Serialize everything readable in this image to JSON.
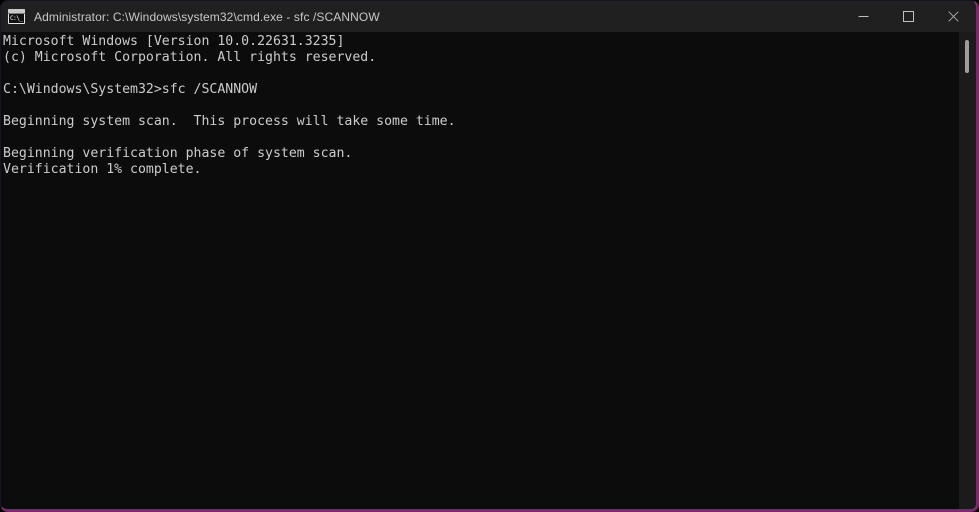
{
  "window": {
    "title": "Administrator: C:\\Windows\\system32\\cmd.exe - sfc  /SCANNOW",
    "icon_name": "cmd-exe-icon",
    "icon_glyph": "C:\\_",
    "background_color": "#0c0c0c",
    "titlebar_color": "#202020",
    "border_accent_color": "#7a2a6e"
  },
  "window_controls": {
    "minimize_label": "Minimize",
    "maximize_label": "Maximize",
    "close_label": "Close"
  },
  "terminal": {
    "text_color": "#cccccc",
    "lines": [
      "Microsoft Windows [Version 10.0.22631.3235]",
      "(c) Microsoft Corporation. All rights reserved.",
      "",
      "C:\\Windows\\System32>sfc /SCANNOW",
      "",
      "Beginning system scan.  This process will take some time.",
      "",
      "Beginning verification phase of system scan.",
      "Verification 1% complete."
    ],
    "content": "Microsoft Windows [Version 10.0.22631.3235]\n(c) Microsoft Corporation. All rights reserved.\n\nC:\\Windows\\System32>sfc /SCANNOW\n\nBeginning system scan.  This process will take some time.\n\nBeginning verification phase of system scan.\nVerification 1% complete.",
    "os_version": "10.0.22631.3235",
    "copyright": "(c) Microsoft Corporation. All rights reserved.",
    "prompt_path": "C:\\Windows\\System32>",
    "command": "sfc /SCANNOW",
    "progress_percent": "1%",
    "status_message": "Verification 1% complete."
  },
  "scrollbar": {
    "thumb_color": "#9e9e9e",
    "track_color": "#1b1b1b"
  }
}
